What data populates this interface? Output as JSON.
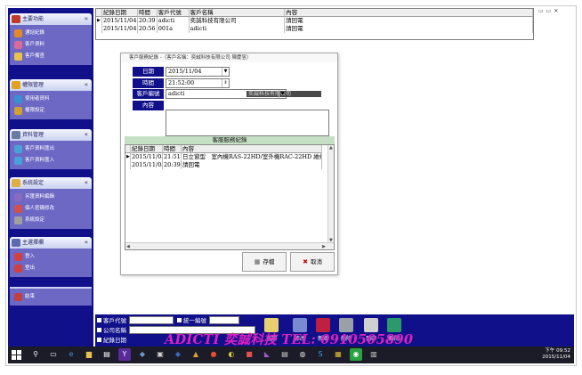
{
  "sidebar": {
    "sections": [
      {
        "title": "主要功能",
        "items": [
          "通話紀錄",
          "客戶資料",
          "客戶備查"
        ]
      },
      {
        "title": "權限管理",
        "items": [
          "使用者資料",
          "權限設定"
        ]
      },
      {
        "title": "資料管理",
        "items": [
          "客戶資料匯出",
          "客戶資料匯入"
        ]
      },
      {
        "title": "系統設定",
        "items": [
          "另匯資料編輯",
          "個人密碼修改",
          "系統設定"
        ]
      },
      {
        "title": "主選擇欄",
        "items": [
          "登入",
          "登出"
        ]
      },
      {
        "title": "",
        "items": [
          "結束"
        ]
      }
    ]
  },
  "toplist": {
    "columns": [
      "紀錄日期",
      "時間",
      "客戶代號",
      "客戶名稱",
      "內容"
    ],
    "rows": [
      {
        "indicator": "▶",
        "date": "2015/11/04",
        "time": "20:39",
        "code": "adicti",
        "name": "奕誠科技有限公司",
        "content": "請回電"
      },
      {
        "indicator": "",
        "date": "2015/11/04",
        "time": "20:56",
        "code": "001a",
        "name": "adicti",
        "content": "請回電"
      }
    ]
  },
  "dialog": {
    "title": "客戶服務紀錄 -（客戶名稱：奕誠科技有限公司 陳慶昱）",
    "labels": {
      "date": "日期",
      "time": "時間",
      "customer": "客戶編號",
      "content": "內容"
    },
    "values": {
      "date": "2015/11/04",
      "time": "21:52:00",
      "customer_code": "adicti",
      "customer_name": "奕誠科技有限公司",
      "content": ""
    },
    "records_title": "客服服務紀錄",
    "grid": {
      "columns": [
        "紀錄日期",
        "時間",
        "內容"
      ],
      "rows": [
        {
          "indicator": "▶",
          "date": "2015/11/04",
          "time": "21:51",
          "content": "日立窗型　室內機RAS-22HD/室外機RAC-22HD 維修："
        },
        {
          "indicator": "",
          "date": "2015/11/04",
          "time": "20:39",
          "content": "請回電"
        }
      ]
    },
    "buttons": {
      "save": "存檔",
      "cancel": "取消"
    }
  },
  "bottom": {
    "filters": [
      "客戶代號",
      "統一編號",
      "公司名稱",
      "紀錄日期"
    ],
    "tools": [
      "查詢",
      "修改",
      "新增",
      "刪除",
      "列印",
      "離開"
    ],
    "watermark": "ADICTI 奕誠科技 TEL: 0910505890"
  },
  "taskbar": {
    "time": "下午 09:52",
    "date": "2015/11/04"
  },
  "colors": {
    "navy": "#10108a",
    "sidebar_body": "#6c68c4",
    "records_head": "#c6e0c6",
    "watermark": "#e020c0"
  }
}
